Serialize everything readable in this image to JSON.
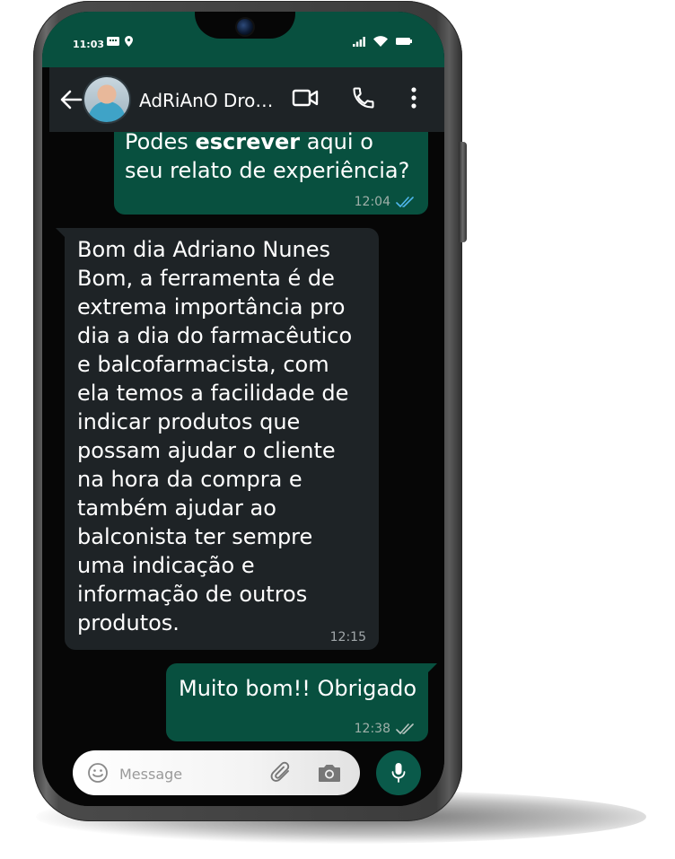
{
  "status_bar": {
    "time": "11:03"
  },
  "header": {
    "contact_name": "AdRiAnO Drogaria"
  },
  "messages": [
    {
      "direction": "outgoing",
      "lines": [
        "Podes ",
        "escrever",
        "  aqui o",
        "seu relato de experiência?"
      ],
      "time": "12:04",
      "ticks": "read"
    },
    {
      "direction": "incoming",
      "lines": [
        "Bom dia Adriano Nunes",
        "Bom, a ferramenta é de",
        "extrema importância pro",
        "dia a dia do farmacêutico",
        "e balcofarmacista, com",
        "ela temos a facilidade de",
        "indicar produtos que",
        "possam ajudar o cliente",
        "na hora da compra e",
        "também ajudar ao",
        "balconista ter sempre",
        "uma indicação e",
        "informação de outros",
        "produtos."
      ],
      "time": "12:15"
    },
    {
      "direction": "outgoing",
      "lines": [
        "Muito bom!! Obrigado"
      ],
      "time": "12:38",
      "ticks": "delivered"
    }
  ],
  "composer": {
    "placeholder": "Message"
  },
  "colors": {
    "accent": "#08503f",
    "header_bg": "#1e2326",
    "incoming_bubble": "#1e2326",
    "read_tick": "#4fb6ec"
  }
}
